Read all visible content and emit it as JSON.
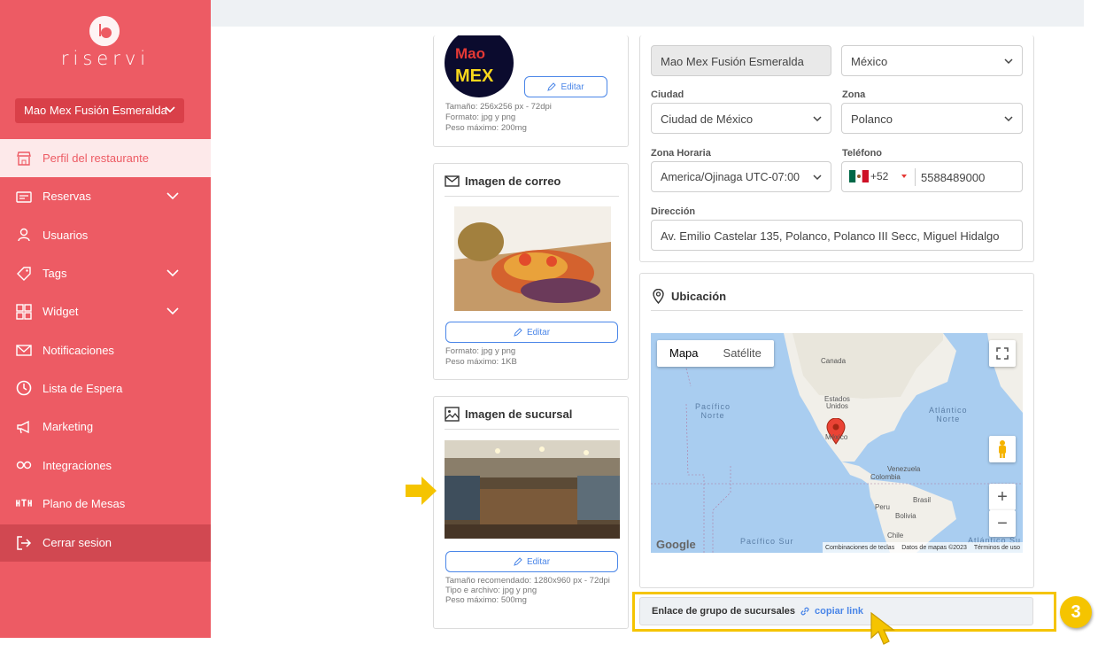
{
  "app": {
    "logo_text": "riservi"
  },
  "branch_selector": {
    "value": "Mao Mex Fusión Esmeralda"
  },
  "nav": {
    "items": [
      {
        "label": "Perfil del restaurante",
        "icon": "store-icon",
        "active": true,
        "expandable": false
      },
      {
        "label": "Reservas",
        "icon": "reservations-icon",
        "active": false,
        "expandable": true
      },
      {
        "label": "Usuarios",
        "icon": "user-icon",
        "active": false,
        "expandable": false
      },
      {
        "label": "Tags",
        "icon": "tag-icon",
        "active": false,
        "expandable": true
      },
      {
        "label": "Widget",
        "icon": "widget-icon",
        "active": false,
        "expandable": true
      },
      {
        "label": "Notificaciones",
        "icon": "mail-icon",
        "active": false,
        "expandable": false
      },
      {
        "label": "Lista de Espera",
        "icon": "clock-icon",
        "active": false,
        "expandable": false
      },
      {
        "label": "Marketing",
        "icon": "megaphone-icon",
        "active": false,
        "expandable": false
      },
      {
        "label": "Integraciones",
        "icon": "integrations-icon",
        "active": false,
        "expandable": false
      },
      {
        "label": "Plano de Mesas",
        "icon": "floor-plan-icon",
        "active": false,
        "expandable": false
      }
    ],
    "logout": "Cerrar sesion"
  },
  "logo_card": {
    "logo_top_text": "Mao",
    "logo_bottom_text": "MEX",
    "edit_label": "Editar",
    "notes": [
      "Tamaño: 256x256 px - 72dpi",
      "Formato: jpg y png",
      "Peso máximo: 200mg"
    ]
  },
  "email_image_card": {
    "title": "Imagen de correo",
    "edit_label": "Editar",
    "notes": [
      "Formato: jpg y png",
      "Peso máximo: 1KB"
    ]
  },
  "branch_image_card": {
    "title": "Imagen de sucursal",
    "edit_label": "Editar",
    "notes": [
      "Tamaño recomendado: 1280x960 px - 72dpi",
      "Tipo e archivo: jpg y png",
      "Peso máximo: 500mg"
    ]
  },
  "form": {
    "name_value": "Mao Mex Fusión Esmeralda",
    "country_value": "México",
    "city_label": "Ciudad",
    "city_value": "Ciudad de México",
    "zone_label": "Zona",
    "zone_value": "Polanco",
    "timezone_label": "Zona Horaria",
    "timezone_value": "America/Ojinaga UTC-07:00",
    "phone_label": "Teléfono",
    "phone_code": "+52",
    "phone_value": "5588489000",
    "address_label": "Dirección",
    "address_value": "Av. Emilio Castelar 135, Polanco, Polanco III Secc, Miguel Hidalgo"
  },
  "location": {
    "title": "Ubicación",
    "map_tab_map": "Mapa",
    "map_tab_satellite": "Satélite",
    "labels": {
      "canada": "Canada",
      "usa_line1": "Estados",
      "usa_line2": "Unidos",
      "mexico": "México",
      "venezuela": "Venezuela",
      "colombia": "Colombia",
      "peru": "Peru",
      "brasil": "Brasil",
      "bolivia": "Bolivia",
      "chile": "Chile"
    },
    "pacific_north_line1": "Pacífico",
    "pacific_north_line2": "Norte",
    "atlantic_north_line1": "Atlántico",
    "atlantic_north_line2": "Norte",
    "pacific_south": "Pacífico Sur",
    "atlantic_south": "Atlántico Su",
    "google_logo": "Google",
    "footer": [
      "Combinaciones de teclas",
      "Datos de mapas ©2023",
      "Términos de uso"
    ]
  },
  "group_link": {
    "label": "Enlace de grupo de sucursales",
    "copy_label": "copiar link"
  },
  "tutorial": {
    "step_number": "3"
  },
  "colors": {
    "brand": "#ed5b64",
    "brand_dark": "#d14851",
    "link": "#4a86e8",
    "highlight": "#f5c400"
  }
}
